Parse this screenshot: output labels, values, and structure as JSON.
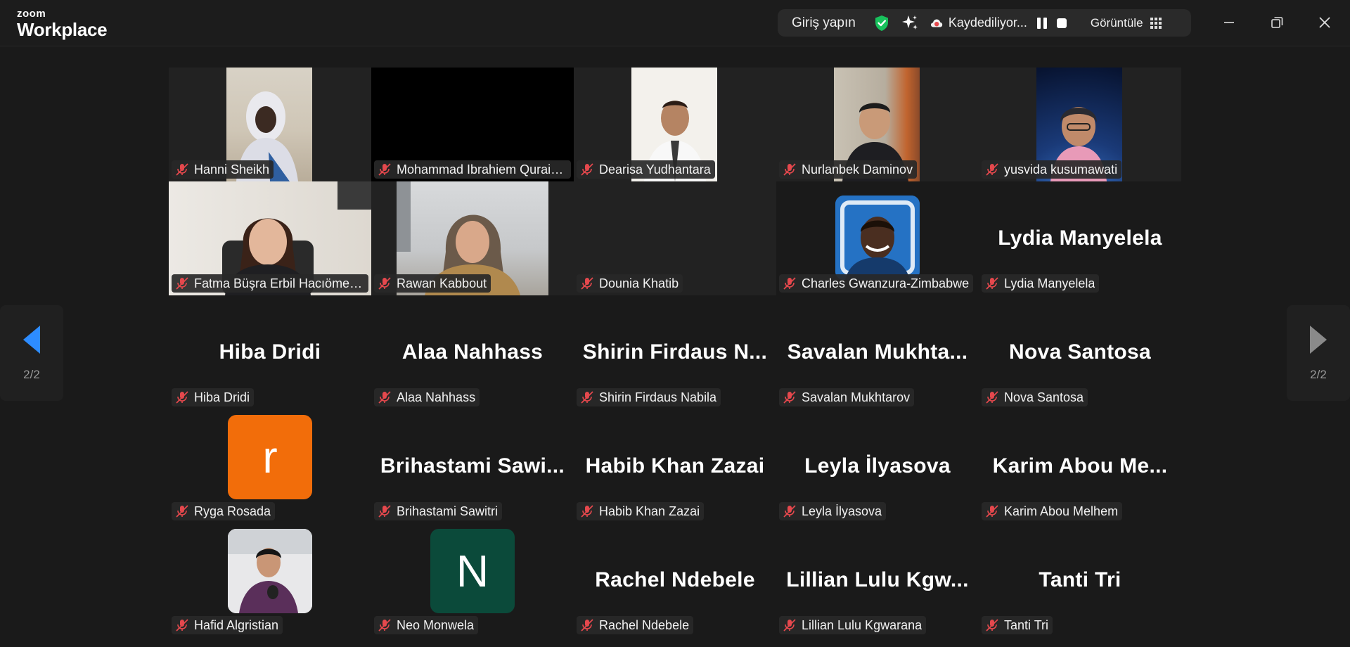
{
  "app": {
    "logo_small": "zoom",
    "logo_big": "Workplace"
  },
  "toolbar": {
    "signin": "Giriş yapın",
    "recording": "Kaydediliyor...",
    "view": "Görüntüle"
  },
  "nav": {
    "left_page": "2/2",
    "right_page": "2/2"
  },
  "colors": {
    "accent_blue": "#2d8cff",
    "shield_green": "#18c15c",
    "muted_red": "#e5484d",
    "orange_avatar": "#f26d0a",
    "green_avatar": "#0b4a3a"
  },
  "participants": [
    {
      "name": "Hanni Sheikh",
      "display": "",
      "muted": true,
      "kind": "video"
    },
    {
      "name": "Mohammad Ibrahiem Quraishi",
      "display": "",
      "muted": true,
      "kind": "black"
    },
    {
      "name": "Dearisa Yudhantara",
      "display": "",
      "muted": true,
      "kind": "video"
    },
    {
      "name": "Nurlanbek Daminov",
      "display": "",
      "muted": true,
      "kind": "video"
    },
    {
      "name": "yusvida kusumawati",
      "display": "",
      "muted": true,
      "kind": "video"
    },
    {
      "name": "Fatma Büşra Erbil Hacıömeroğlu",
      "display": "",
      "muted": true,
      "kind": "video"
    },
    {
      "name": "Rawan Kabbout",
      "display": "",
      "muted": true,
      "kind": "video"
    },
    {
      "name": "Dounia Khatib",
      "display": "",
      "muted": true,
      "kind": "empty"
    },
    {
      "name": "Charles Gwanzura-Zimbabwe",
      "display": "",
      "muted": true,
      "kind": "photo"
    },
    {
      "name": "Lydia Manyelela",
      "display": "Lydia Manyelela",
      "muted": true,
      "kind": "text"
    },
    {
      "name": "Hiba Dridi",
      "display": "Hiba Dridi",
      "muted": true,
      "kind": "text"
    },
    {
      "name": "Alaa Nahhass",
      "display": "Alaa Nahhass",
      "muted": true,
      "kind": "text"
    },
    {
      "name": "Shirin Firdaus Nabila",
      "display": "Shirin Firdaus N...",
      "muted": true,
      "kind": "text"
    },
    {
      "name": "Savalan Mukhtarov",
      "display": "Savalan Mukhta...",
      "muted": true,
      "kind": "text"
    },
    {
      "name": "Nova Santosa",
      "display": "Nova Santosa",
      "muted": true,
      "kind": "text"
    },
    {
      "name": "Ryga Rosada",
      "display": "",
      "muted": true,
      "kind": "letter",
      "letter": "r"
    },
    {
      "name": "Brihastami Sawitri",
      "display": "Brihastami Sawi...",
      "muted": true,
      "kind": "text"
    },
    {
      "name": "Habib Khan Zazai",
      "display": "Habib Khan Zazai",
      "muted": true,
      "kind": "text"
    },
    {
      "name": "Leyla İlyasova",
      "display": "Leyla İlyasova",
      "muted": true,
      "kind": "text"
    },
    {
      "name": "Karim Abou Melhem",
      "display": "Karim Abou Me...",
      "muted": true,
      "kind": "text"
    },
    {
      "name": "Hafid Algristian",
      "display": "",
      "muted": true,
      "kind": "photo"
    },
    {
      "name": "Neo Monwela",
      "display": "",
      "muted": true,
      "kind": "letter",
      "letter": "N"
    },
    {
      "name": "Rachel Ndebele",
      "display": "Rachel Ndebele",
      "muted": true,
      "kind": "text"
    },
    {
      "name": "Lillian Lulu Kgwarana",
      "display": "Lillian Lulu Kgw...",
      "muted": true,
      "kind": "text"
    },
    {
      "name": "Tanti Tri",
      "display": "Tanti Tri",
      "muted": true,
      "kind": "text"
    }
  ]
}
